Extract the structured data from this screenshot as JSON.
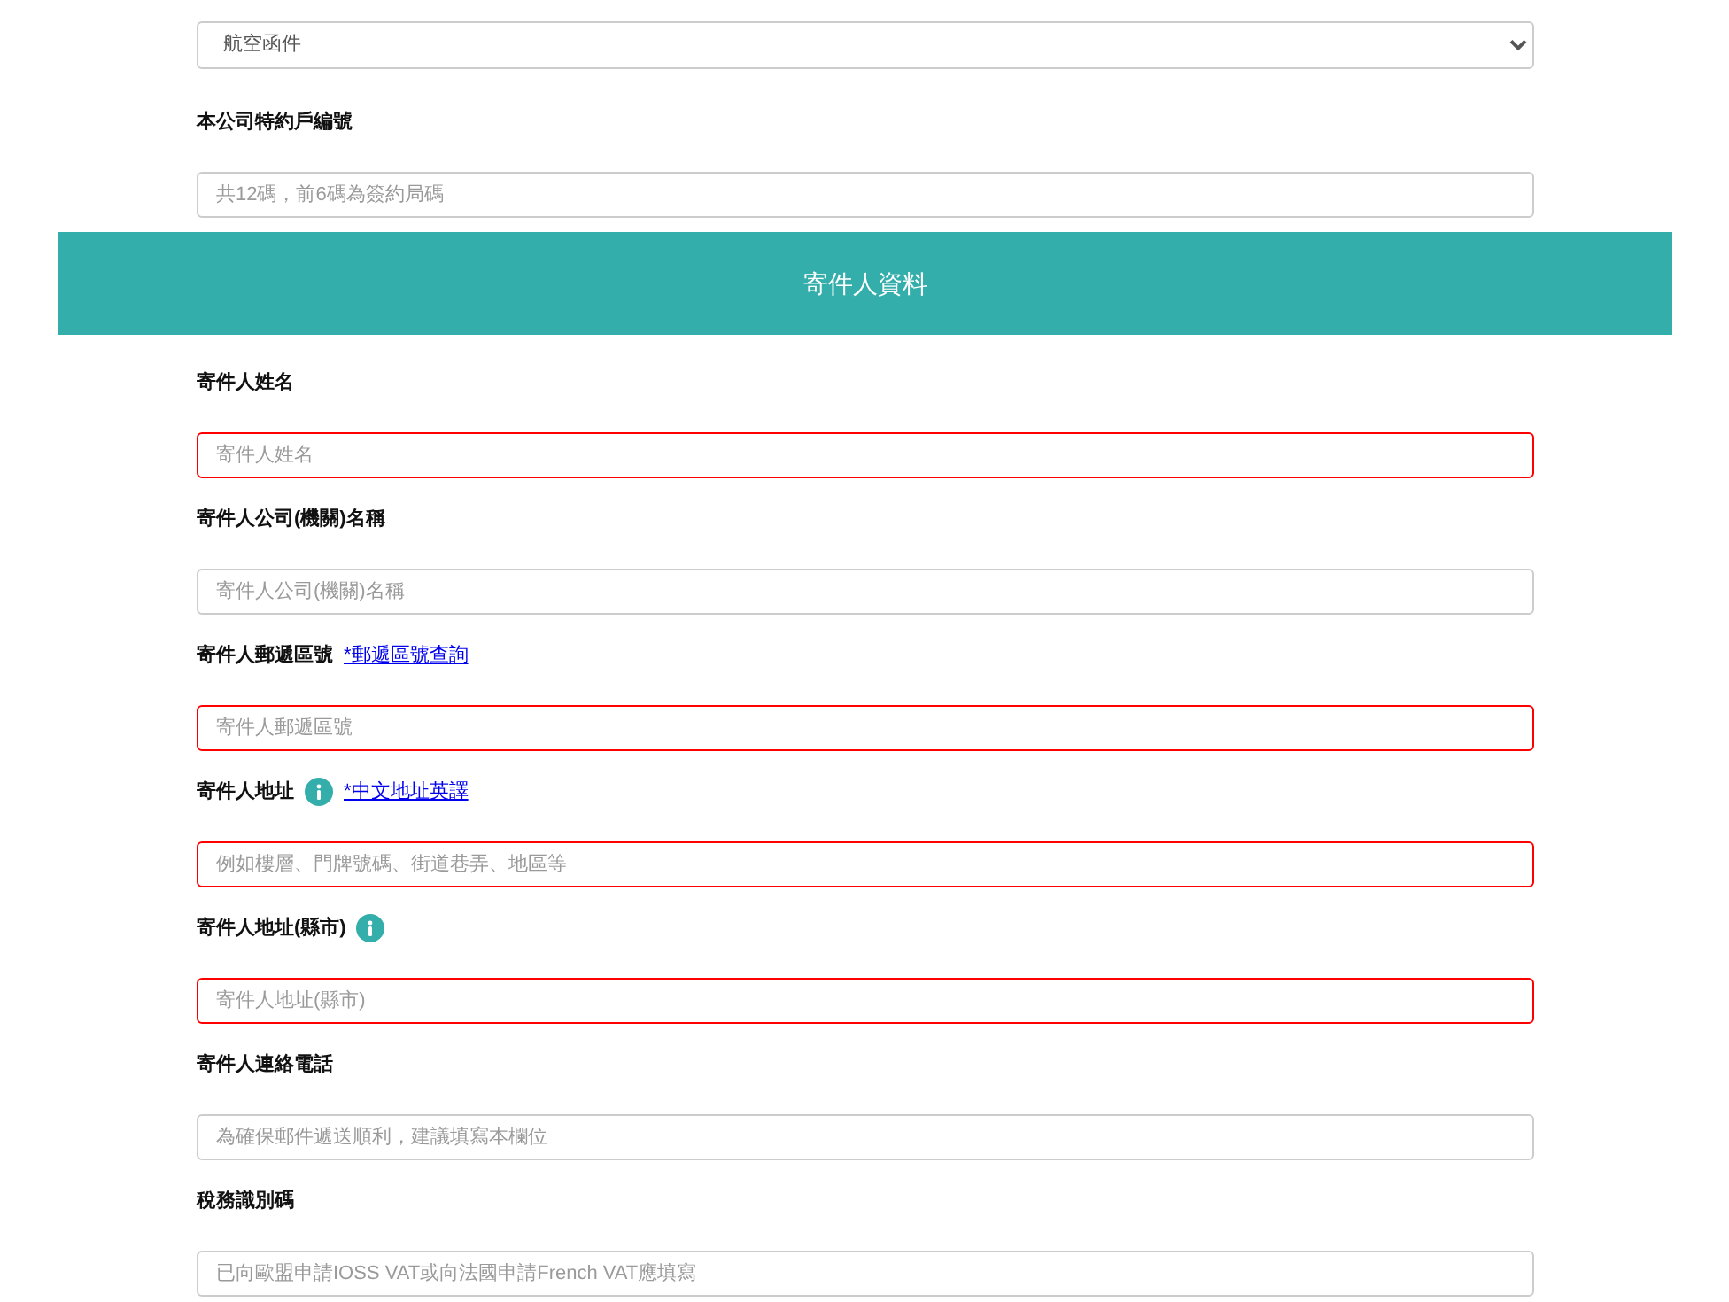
{
  "shipping_form": {
    "mail_type": {
      "value": "航空函件"
    },
    "fields": [
      {
        "label": "本公司特約戶編號",
        "placeholder": "共12碼，前6碼為簽約局碼",
        "invalid": false,
        "info": false
      }
    ]
  },
  "sender_section": {
    "title": "寄件人資料",
    "fields": [
      {
        "label": "寄件人姓名",
        "placeholder": "寄件人姓名",
        "invalid": true,
        "info": false
      },
      {
        "label": "寄件人公司(機關)名稱",
        "placeholder": "寄件人公司(機關)名稱",
        "invalid": false,
        "info": false
      },
      {
        "label": "寄件人郵遞區號",
        "link": "*郵遞區號查詢",
        "placeholder": "寄件人郵遞區號",
        "invalid": true,
        "info": false
      },
      {
        "label": "寄件人地址",
        "link": "*中文地址英譯",
        "placeholder": "例如樓層、門牌號碼、街道巷弄、地區等",
        "invalid": true,
        "info": true
      },
      {
        "label": "寄件人地址(縣市)",
        "placeholder": "寄件人地址(縣市)",
        "invalid": true,
        "info": true
      },
      {
        "label": "寄件人連絡電話",
        "placeholder": "為確保郵件遞送順利，建議填寫本欄位",
        "invalid": false,
        "info": false
      },
      {
        "label": "稅務識別碼",
        "placeholder": "已向歐盟申請IOSS VAT或向法國申請French VAT應填寫",
        "invalid": false,
        "info": false
      }
    ]
  }
}
